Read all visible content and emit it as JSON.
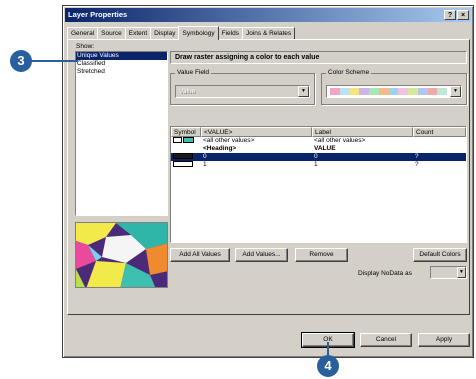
{
  "dialog": {
    "title": "Layer Properties",
    "help_button": "?",
    "close_button": "×"
  },
  "tabs": [
    "General",
    "Source",
    "Extent",
    "Display",
    "Symbology",
    "Fields",
    "Joins & Relates"
  ],
  "active_tab": "Symbology",
  "show": {
    "label": "Show:",
    "items": [
      "Unique Values",
      "Classified",
      "Stretched"
    ],
    "selected": "Unique Values"
  },
  "header": "Draw raster assigning a color to each value",
  "value_field": {
    "label": "Value Field",
    "value": "Value"
  },
  "color_scheme": {
    "label": "Color Scheme",
    "colors": [
      "#f5a3c7",
      "#b9e3f5",
      "#f7e27c",
      "#c9b5e8",
      "#a8e6b3",
      "#f7b98a",
      "#9fd2ef",
      "#f3c1e3",
      "#d5e99a",
      "#b3c5f0",
      "#f0a8a8",
      "#bde8d8"
    ]
  },
  "table": {
    "headers": [
      "Symbol",
      "<VALUE>",
      "Label",
      "Count"
    ],
    "rows": [
      {
        "symbol_color": "#3fbfb0",
        "value": "<all other values>",
        "label": "<all other values>",
        "count": "",
        "bold": false,
        "selected": false,
        "symbol": true
      },
      {
        "symbol_color": "",
        "value": "<Heading>",
        "label": "VALUE",
        "count": "",
        "bold": true,
        "selected": false,
        "symbol": false
      },
      {
        "symbol_color": "#1a1a1a",
        "value": "0",
        "label": "0",
        "count": "?",
        "bold": false,
        "selected": true,
        "symbol": true
      },
      {
        "symbol_color": "#ffffff",
        "value": "1",
        "label": "1",
        "count": "?",
        "bold": false,
        "selected": false,
        "symbol": true
      }
    ]
  },
  "buttons": {
    "add_all_values": "Add All Values",
    "add_values": "Add Values...",
    "remove": "Remove",
    "default_colors": "Default Colors",
    "ok": "OK",
    "cancel": "Cancel",
    "apply": "Apply"
  },
  "nodata": {
    "label": "Display NoData as"
  },
  "callouts": {
    "step_3": "3",
    "step_4": "4"
  },
  "colors": {
    "dialog_bg": "#d4d0c8",
    "title_start": "#0a246a",
    "selection": "#0a246a",
    "callout": "#2a5f9e"
  }
}
